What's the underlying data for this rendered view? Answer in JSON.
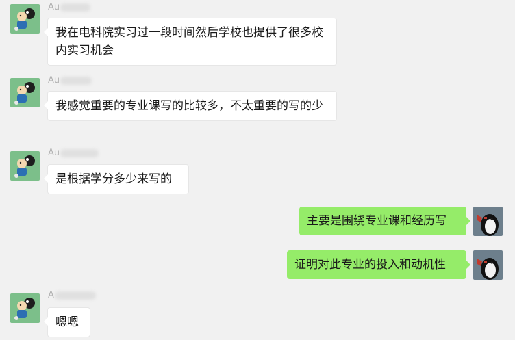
{
  "colors": {
    "background": "#f1f1f1",
    "incoming_bubble": "#ffffff",
    "outgoing_bubble": "#95ec69",
    "sender_name": "#b2b2b2",
    "text": "#1a1a1a"
  },
  "messages": [
    {
      "direction": "incoming",
      "sender": "Au",
      "avatar_icon": "cartoon-character-avatar-icon",
      "text": "我在电科院实习过一段时间然后学校也提供了很多校内实习机会"
    },
    {
      "direction": "incoming",
      "sender": "Au",
      "avatar_icon": "cartoon-character-avatar-icon",
      "text": "我感觉重要的专业课写的比较多，不太重要的写的少"
    },
    {
      "direction": "incoming",
      "sender": "Au",
      "avatar_icon": "cartoon-character-avatar-icon",
      "text": "是根据学分多少来写的"
    },
    {
      "direction": "outgoing",
      "avatar_icon": "penguin-avatar-icon",
      "text": "主要是围绕专业课和经历写"
    },
    {
      "direction": "outgoing",
      "avatar_icon": "penguin-avatar-icon",
      "text": "证明对此专业的投入和动机性"
    },
    {
      "direction": "incoming",
      "sender": "A",
      "avatar_icon": "cartoon-character-avatar-icon",
      "text": "嗯嗯"
    }
  ]
}
